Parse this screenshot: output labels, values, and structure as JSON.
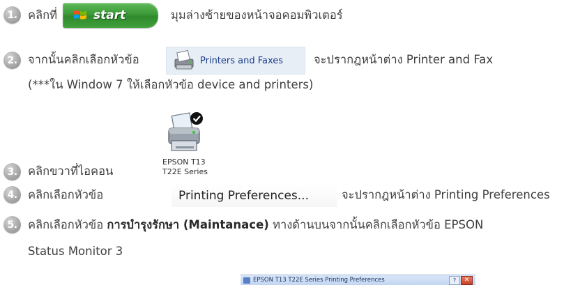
{
  "steps": [
    {
      "num": "1.",
      "before": "คลิกที่",
      "after": "มุมล่างซ้ายของหน้าจอคอมพิวเตอร์"
    },
    {
      "num": "2.",
      "before": "จากนั้นคลิกเลือกหัวข้อ",
      "after": "จะปรากฎหน้าต่าง Printer and Fax",
      "line2": "(***ใน Window 7 ให้เลือกหัวข้อ device and printers)"
    },
    {
      "num": "3.",
      "before": "คลิกขวาที่ไอคอน"
    },
    {
      "num": "4.",
      "before": "คลิกเลือกหัวข้อ",
      "after": "จะปรากฎหน้าต่าง Printing Preferences"
    },
    {
      "num": "5.",
      "before": "คลิกเลือกหัวข้อ",
      "bold": "การบำรุงรักษา (Maintanace)",
      "after": "ทางด้านบนจากนั้นคลิกเลือกหัวข้อ EPSON",
      "line2": "Status Monitor 3"
    }
  ],
  "start_button": {
    "label": "start",
    "icon": "windows-flag-icon"
  },
  "printers_faxes": {
    "label": "Printers and Faxes",
    "icon": "printer-fax-icon"
  },
  "printer_icon": {
    "line1": "EPSON T13",
    "line2": "T22E Series",
    "icon": "printer-default-icon"
  },
  "printing_prefs": {
    "label": "Printing Preferences..."
  },
  "dialog": {
    "title": "EPSON T13 T22E Series Printing Preferences",
    "help": "?",
    "close": "✕"
  },
  "colors": {
    "bullet": "#a9a9a9",
    "start_green": "#3c9a38",
    "pf_bg": "#e8eef6"
  }
}
